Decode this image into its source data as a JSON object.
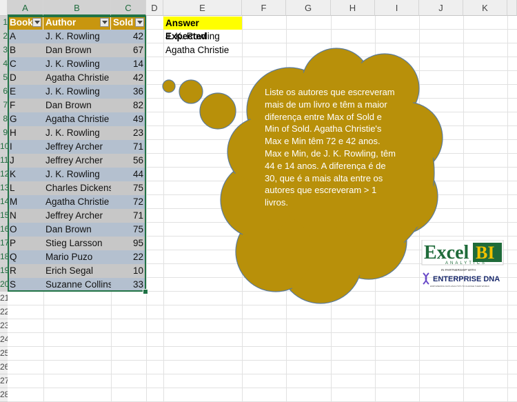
{
  "columns": [
    "A",
    "B",
    "C",
    "D",
    "E",
    "F",
    "G",
    "H",
    "I",
    "J",
    "K"
  ],
  "row_numbers": [
    "1",
    "2",
    "3",
    "4",
    "5",
    "6",
    "7",
    "8",
    "9",
    "10",
    "11",
    "12",
    "13",
    "14",
    "15",
    "16",
    "17",
    "18",
    "19",
    "20",
    "21",
    "22",
    "23",
    "24",
    "25",
    "26",
    "27",
    "28"
  ],
  "table": {
    "headers": [
      "Book",
      "Author",
      "Sold"
    ],
    "rows": [
      {
        "book": "A",
        "author": "J. K. Rowling",
        "sold": "42"
      },
      {
        "book": "B",
        "author": "Dan Brown",
        "sold": "67"
      },
      {
        "book": "C",
        "author": "J. K. Rowling",
        "sold": "14"
      },
      {
        "book": "D",
        "author": "Agatha Christie",
        "sold": "42"
      },
      {
        "book": "E",
        "author": "J. K. Rowling",
        "sold": "36"
      },
      {
        "book": "F",
        "author": "Dan Brown",
        "sold": "82"
      },
      {
        "book": "G",
        "author": "Agatha Christie",
        "sold": "49"
      },
      {
        "book": "H",
        "author": "J. K. Rowling",
        "sold": "23"
      },
      {
        "book": "I",
        "author": "Jeffrey Archer",
        "sold": "71"
      },
      {
        "book": "J",
        "author": "Jeffrey Archer",
        "sold": "56"
      },
      {
        "book": "K",
        "author": "J. K. Rowling",
        "sold": "44"
      },
      {
        "book": "L",
        "author": "Charles Dickens",
        "sold": "75"
      },
      {
        "book": "M",
        "author": "Agatha Christie",
        "sold": "72"
      },
      {
        "book": "N",
        "author": "Jeffrey Archer",
        "sold": "71"
      },
      {
        "book": "O",
        "author": "Dan Brown",
        "sold": "75"
      },
      {
        "book": "P",
        "author": "Stieg Larsson",
        "sold": "95"
      },
      {
        "book": "Q",
        "author": "Mario Puzo",
        "sold": "22"
      },
      {
        "book": "R",
        "author": "Erich Segal",
        "sold": "10"
      },
      {
        "book": "S",
        "author": "Suzanne Collins",
        "sold": "33"
      }
    ]
  },
  "answer": {
    "header": "Answer Expected",
    "values": [
      "J. K. Rowling",
      "Agatha Christie"
    ]
  },
  "bubble": {
    "text": "Liste os autores que escreveram mais de um livro e têm a maior diferença entre Max of Sold e Min of Sold. Agatha Christie's Max e Min têm 72 e 42 anos. Max e Min, de J. K. Rowling, têm 44 e 14 anos. A diferença é de 30, que é a mais alta entre os autores que escreveram > 1 livros."
  },
  "logo": {
    "word1": "Excel",
    "word2": "BI",
    "tagline": "ANALYTICS",
    "partner": "IN PARTNERSHIP WITH",
    "brand": "ENTERPRISE DNA",
    "small": "EMPOWERING DATA ANALYSTS TO CHANGE THEIR WORLD"
  },
  "colors": {
    "header_gold": "#c8960f",
    "row_blue": "#b4c0cf",
    "row_gray": "#c7c7c7",
    "bubble": "#b8900a",
    "highlight": "#ffff00",
    "excel_green": "#217346"
  }
}
